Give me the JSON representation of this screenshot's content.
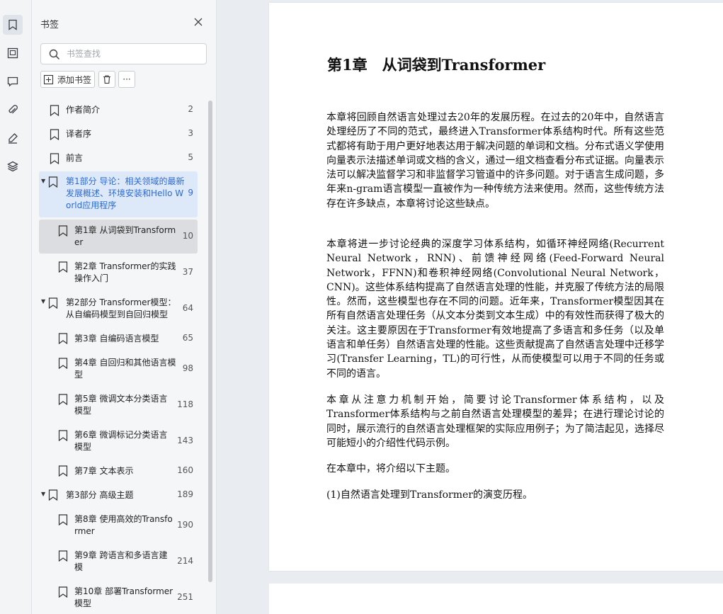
{
  "sidebar_rail": {
    "icons": [
      "bookmark-icon",
      "image-icon",
      "comment-icon",
      "attachment-icon",
      "pen-icon",
      "layers-icon"
    ]
  },
  "bookmark_panel": {
    "title": "书签",
    "search_placeholder": "书签查找",
    "add_label": "添加书签",
    "more_label": "···",
    "items": [
      {
        "label": "作者简介",
        "page": "2"
      },
      {
        "label": "译者序",
        "page": "3"
      },
      {
        "label": "前言",
        "page": "5"
      },
      {
        "label": "第1部分 导论：相关领域的最新发展概述、环境安装和Hello World应用程序",
        "page": "9"
      },
      {
        "label": "第1章 从词袋到Transformer",
        "page": "10"
      },
      {
        "label": "第2章 Transformer的实践操作入门",
        "page": "37"
      },
      {
        "label": "第2部分 Transformer模型：从自编码模型到自回归模型",
        "page": "64"
      },
      {
        "label": "第3章 自编码语言模型",
        "page": "65"
      },
      {
        "label": "第4章 自回归和其他语言模型",
        "page": "98"
      },
      {
        "label": "第5章 微调文本分类语言模型",
        "page": "118"
      },
      {
        "label": "第6章 微调标记分类语言模型",
        "page": "143"
      },
      {
        "label": "第7章 文本表示",
        "page": "160"
      },
      {
        "label": "第3部分 高级主题",
        "page": "189"
      },
      {
        "label": "第8章 使用高效的Transformer",
        "page": "190"
      },
      {
        "label": "第9章 跨语言和多语言建模",
        "page": "214"
      },
      {
        "label": "第10章 部署Transformer模型",
        "page": "251"
      }
    ]
  },
  "document": {
    "chapter_title": "第1章　从词袋到Transformer",
    "paragraphs": [
      "本章将回顾自然语言处理过去20年的发展历程。在过去的20年中，自然语言处理经历了不同的范式，最终进入Transformer体系结构时代。所有这些范式都将有助于用户更好地表达用于解决问题的单词和文档。分布式语义学使用向量表示法描述单词或文档的含义，通过一组文档查看分布式证据。向量表示法可以解决监督学习和非监督学习管道中的许多问题。对于语言生成问题，多年来n-gram语言模型一直被作为一种传统方法来使用。然而，这些传统方法存在许多缺点，本章将讨论这些缺点。",
      "本章将进一步讨论经典的深度学习体系结构，如循环神经网络(Recurrent Neural Network，RNN)、前馈神经网络(Feed-Forward Neural Network，FFNN)和卷积神经网络(Convolutional Neural Network，CNN)。这些体系结构提高了自然语言处理的性能，并克服了传统方法的局限性。然而，这些模型也存在不同的问题。近年来，Transformer模型因其在所有自然语言处理任务（从文本分类到文本生成）中的有效性而获得了极大的关注。这主要原因在于Transformer有效地提高了多语言和多任务（以及单语言和单任务）自然语言处理的性能。这些贡献提高了自然语言处理中迁移学习(Transfer Learning，TL)的可行性，从而使模型可以用于不同的任务或不同的语言。",
      "本章从注意力机制开始，简要讨论Transformer体系结构，以及Transformer体系结构与之前自然语言处理模型的差异；在进行理论讨论的同时，展示流行的自然语言处理框架的实际应用例子；为了简洁起见，选择尽可能短小的介绍性代码示例。",
      "在本章中，将介绍以下主题。",
      "(1)自然语言处理到Transformer的演变历程。"
    ]
  },
  "colors": {
    "selected_text": "#2c6bd6",
    "selected_bg": "#dde8f8",
    "current_bg": "#dcdde0"
  }
}
